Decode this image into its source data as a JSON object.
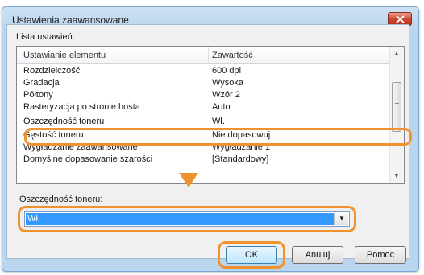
{
  "window": {
    "title": "Ustawienia zaawansowane"
  },
  "settings_list": {
    "label": "Lista ustawień:",
    "columns": [
      "Ustawianie elementu",
      "Zawartość"
    ],
    "rows": [
      {
        "item": "Rozdzielczość",
        "value": "600 dpi"
      },
      {
        "item": "Gradacja",
        "value": "Wysoka"
      },
      {
        "item": "Półtony",
        "value": "Wzór 2"
      },
      {
        "item": "Rasteryzacja po stronie hosta",
        "value": "Auto"
      },
      {
        "item": "Oszczędność toneru",
        "value": "Wł."
      },
      {
        "item": "Gęstość toneru",
        "value": "Nie dopasowuj"
      },
      {
        "item": "Wygładzanie zaawansowane",
        "value": "Wygładzanie 1"
      },
      {
        "item": "Domyślne dopasowanie szarości",
        "value": "[Standardowy]"
      }
    ],
    "selected_index": 4
  },
  "detail": {
    "label": "Oszczędność toneru:",
    "selected_value": "Wł."
  },
  "buttons": {
    "ok": "OK",
    "cancel": "Anuluj",
    "help": "Pomoc"
  },
  "colors": {
    "annotation": "#f0932e",
    "selection": "#3399ff",
    "titlebar": "#bad5ee"
  },
  "icons": {
    "close": "close-icon",
    "dropdown": "chevron-down-icon",
    "annotation_arrow": "arrow-down-icon"
  }
}
